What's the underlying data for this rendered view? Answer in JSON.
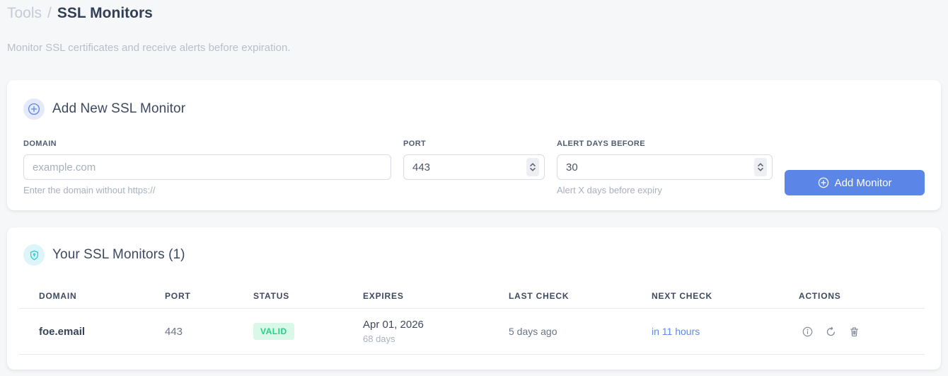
{
  "page": {
    "breadcrumb": {
      "section": "Tools",
      "separator": "/",
      "current": "SSL Monitors"
    },
    "subtitle": "Monitor SSL certificates and receive alerts before expiration."
  },
  "add_monitor": {
    "title": "Add New SSL Monitor",
    "fields": {
      "domain": {
        "label": "DOMAIN",
        "placeholder": "example.com",
        "value": "",
        "helper": "Enter the domain without https://"
      },
      "port": {
        "label": "PORT",
        "value": "443"
      },
      "alert_days": {
        "label": "ALERT DAYS BEFORE",
        "value": "30",
        "helper": "Alert X days before expiry"
      }
    },
    "submit_label": "Add Monitor"
  },
  "monitors": {
    "title": "Your SSL Monitors (1)",
    "table": {
      "headers": [
        "DOMAIN",
        "PORT",
        "STATUS",
        "EXPIRES",
        "LAST CHECK",
        "NEXT CHECK",
        "ACTIONS"
      ],
      "rows": [
        {
          "domain": "foe.email",
          "port": "443",
          "status": "VALID",
          "expires_date": "Apr 01, 2026",
          "expires_days": "68 days",
          "last_check": "5 days ago",
          "next_check": "in 11 hours"
        }
      ]
    }
  },
  "icons": {
    "add_section": "plus-circle-icon",
    "monitors_section": "shield-icon",
    "button": "plus-circle-icon",
    "row_actions": [
      "info-icon",
      "refresh-icon",
      "trash-icon"
    ]
  },
  "colors": {
    "accent_blue": "#5b86e8",
    "shield_cyan": "#2cc7d8",
    "status_valid_bg": "#d9f8e8",
    "status_valid_text": "#27cf86",
    "next_check_text": "#5a8bee",
    "page_background": "#f6f7f9"
  }
}
